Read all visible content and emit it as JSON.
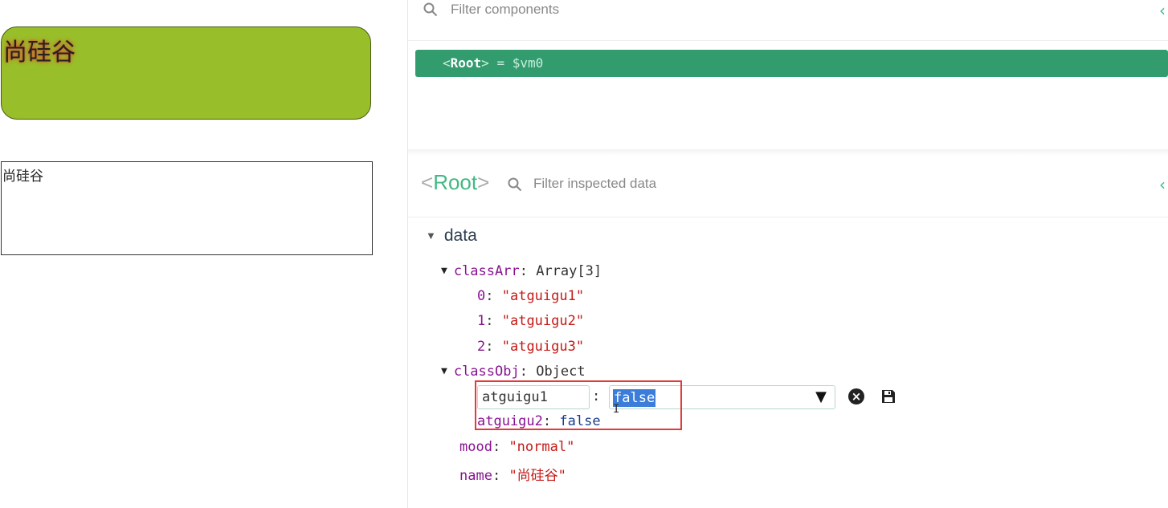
{
  "app": {
    "basic_text": "尚硅谷",
    "plain_text": "尚硅谷"
  },
  "devtools": {
    "components_filter_placeholder": "Filter components",
    "root_row": {
      "open": "<",
      "tag": "Root",
      "close": ">",
      "assign": " = $vm0"
    },
    "inspector": {
      "title_open": "<",
      "title": "Root",
      "title_close": ">",
      "filter_placeholder": "Filter inspected data",
      "section": "data",
      "classArr": {
        "key": "classArr",
        "type": "Array[3]",
        "items": [
          {
            "index": "0",
            "value": "\"atguigu1\""
          },
          {
            "index": "1",
            "value": "\"atguigu2\""
          },
          {
            "index": "2",
            "value": "\"atguigu3\""
          }
        ]
      },
      "classObj": {
        "key": "classObj",
        "type": "Object",
        "edit_key": "atguigu1",
        "edit_value": "false",
        "item2_key": "atguigu2",
        "item2_value": "false"
      },
      "mood": {
        "key": "mood",
        "value": "\"normal\""
      },
      "name": {
        "key": "name",
        "value": "\"尚硅谷\""
      }
    }
  },
  "colors": {
    "accent": "#42b983",
    "selected_row": "#339c6e",
    "basic_box": "#98bf2a",
    "highlight": "#e33b3b"
  }
}
